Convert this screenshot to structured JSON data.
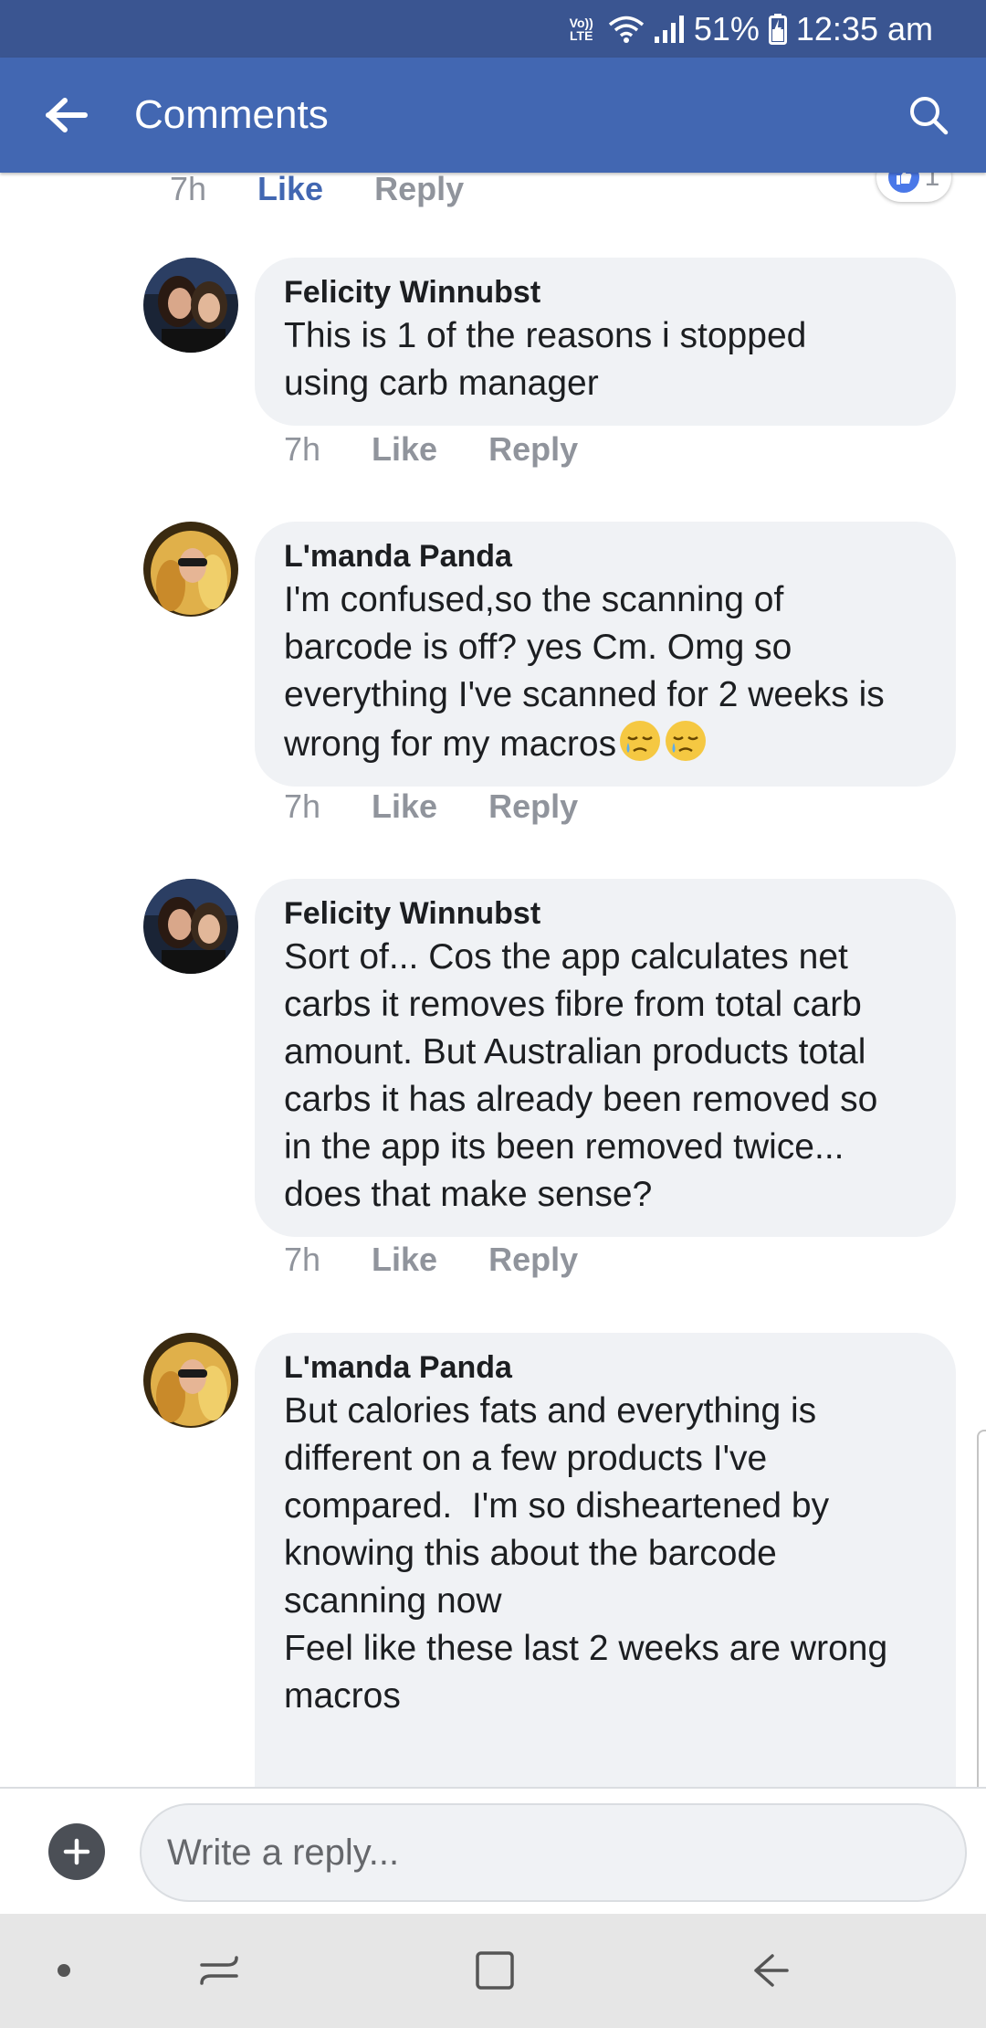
{
  "status_bar": {
    "volte_top": "Vo))",
    "volte_bottom": "LTE",
    "battery_percent": "51%",
    "time": "12:35 am",
    "icons": [
      "wifi-icon",
      "signal-icon",
      "battery-icon"
    ]
  },
  "header": {
    "title": "Comments",
    "back_icon": "back-arrow-icon",
    "search_icon": "search-icon",
    "color": "#4267b2"
  },
  "top_meta": {
    "time": "7h",
    "like_label": "Like",
    "reply_label": "Reply",
    "reaction_count": "1"
  },
  "comments": [
    {
      "author": "Felicity Winnubst",
      "text": "This is 1 of the reasons i stopped\nusing carb manager",
      "time": "7h",
      "like_label": "Like",
      "reply_label": "Reply"
    },
    {
      "author": "L'manda Panda",
      "text": "I'm confused,so the scanning of\nbarcode is off? yes Cm. Omg so\neverything I've scanned for 2 weeks is\nwrong for my macros",
      "emoji": [
        "sleepy-face",
        "sleepy-face"
      ],
      "time": "7h",
      "like_label": "Like",
      "reply_label": "Reply"
    },
    {
      "author": "Felicity Winnubst",
      "text": "Sort of... Cos the app calculates net\ncarbs it removes fibre from total carb\namount. But Australian products total\ncarbs it has already been removed so\nin the app its been removed twice...\ndoes that make sense?",
      "time": "7h",
      "like_label": "Like",
      "reply_label": "Reply"
    },
    {
      "author": "L'manda Panda",
      "text": "But calories fats and everything is\ndifferent on a few products I've\ncompared.  I'm so disheartened by\nknowing this about the barcode\nscanning now\nFeel like these last 2 weeks are wrong\nmacros"
    }
  ],
  "reply_bar": {
    "placeholder": "Write a reply...",
    "add_icon": "plus-icon"
  },
  "nav_bar": {
    "icons": [
      "dot-icon",
      "recents-icon",
      "home-icon",
      "back-icon"
    ]
  }
}
